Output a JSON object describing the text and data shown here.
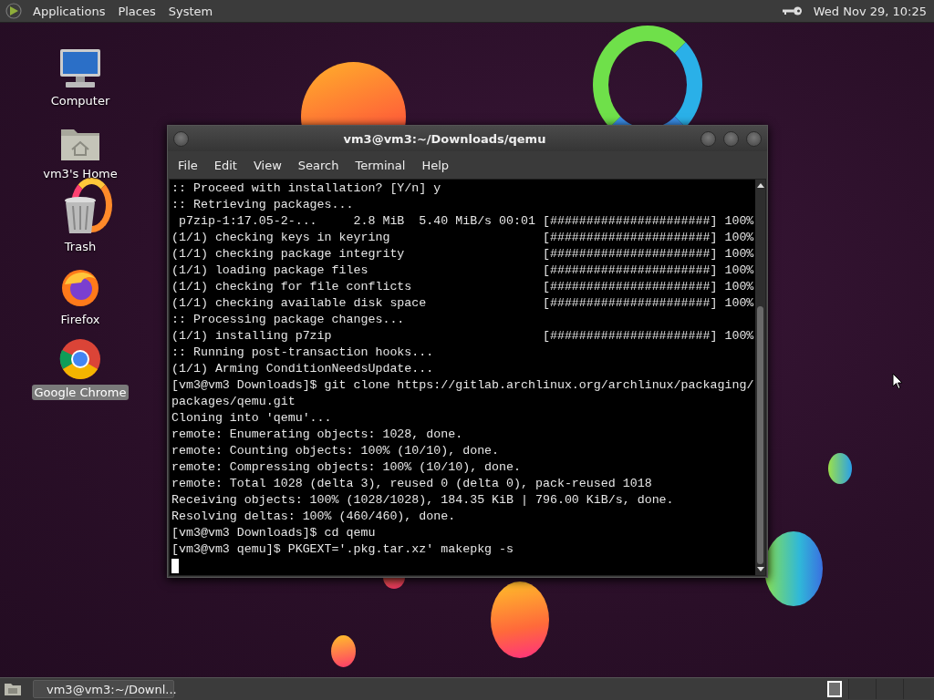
{
  "top_panel": {
    "menus": [
      "Applications",
      "Places",
      "System"
    ],
    "clock": "Wed Nov 29, 10:25"
  },
  "desktop_icons": [
    {
      "kind": "computer",
      "label": "Computer",
      "selected": false
    },
    {
      "kind": "home",
      "label": "vm3's Home",
      "selected": false
    },
    {
      "kind": "trash",
      "label": "Trash",
      "selected": false
    },
    {
      "kind": "firefox",
      "label": "Firefox",
      "selected": false
    },
    {
      "kind": "chrome",
      "label": "Google Chrome",
      "selected": true
    }
  ],
  "window": {
    "title": "vm3@vm3:~/Downloads/qemu",
    "menu": [
      "File",
      "Edit",
      "View",
      "Search",
      "Terminal",
      "Help"
    ],
    "lines": [
      {
        "text": ":: Proceed with installation? [Y/n] y"
      },
      {
        "text": ":: Retrieving packages..."
      },
      {
        "text": " p7zip-1:17.05-2-...     2.8 MiB  5.40 MiB/s 00:01",
        "bar": "[######################] 100%"
      },
      {
        "text": "(1/1) checking keys in keyring",
        "bar": "[######################] 100%"
      },
      {
        "text": "(1/1) checking package integrity",
        "bar": "[######################] 100%"
      },
      {
        "text": "(1/1) loading package files",
        "bar": "[######################] 100%"
      },
      {
        "text": "(1/1) checking for file conflicts",
        "bar": "[######################] 100%"
      },
      {
        "text": "(1/1) checking available disk space",
        "bar": "[######################] 100%"
      },
      {
        "text": ":: Processing package changes..."
      },
      {
        "text": "(1/1) installing p7zip",
        "bar": "[######################] 100%"
      },
      {
        "text": ":: Running post-transaction hooks..."
      },
      {
        "text": "(1/1) Arming ConditionNeedsUpdate..."
      },
      {
        "text": "[vm3@vm3 Downloads]$ git clone https://gitlab.archlinux.org/archlinux/packaging/"
      },
      {
        "text": "packages/qemu.git"
      },
      {
        "text": "Cloning into 'qemu'..."
      },
      {
        "text": "remote: Enumerating objects: 1028, done."
      },
      {
        "text": "remote: Counting objects: 100% (10/10), done."
      },
      {
        "text": "remote: Compressing objects: 100% (10/10), done."
      },
      {
        "text": "remote: Total 1028 (delta 3), reused 0 (delta 0), pack-reused 1018"
      },
      {
        "text": "Receiving objects: 100% (1028/1028), 184.35 KiB | 796.00 KiB/s, done."
      },
      {
        "text": "Resolving deltas: 100% (460/460), done."
      },
      {
        "text": "[vm3@vm3 Downloads]$ cd qemu"
      },
      {
        "text": "[vm3@vm3 qemu]$ PKGEXT='.pkg.tar.xz' makepkg -s"
      }
    ]
  },
  "taskbar": {
    "tasks": [
      {
        "label": "vm3@vm3:~/Downl...",
        "selected": false
      }
    ],
    "workspaces": [
      {
        "selected": true
      },
      {
        "selected": false
      },
      {
        "selected": false
      },
      {
        "selected": false
      }
    ]
  }
}
